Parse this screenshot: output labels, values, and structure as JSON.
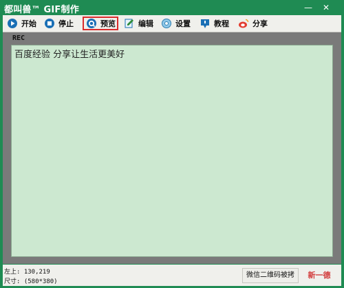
{
  "window": {
    "title": "都叫兽™ GIF制作",
    "minimize_icon": "minimize-icon",
    "close_icon": "close-icon"
  },
  "toolbar": {
    "items": [
      {
        "label": "开始",
        "icon": "play-icon"
      },
      {
        "label": "停止",
        "icon": "stop-icon"
      },
      {
        "label": "预览",
        "icon": "preview-icon"
      },
      {
        "label": "编辑",
        "icon": "edit-icon"
      },
      {
        "label": "设置",
        "icon": "gear-icon"
      },
      {
        "label": "教程",
        "icon": "tutorial-icon"
      },
      {
        "label": "分享",
        "icon": "weibo-icon"
      }
    ]
  },
  "recording": {
    "label": "REC",
    "text": "百度经验 分享让生活更美好"
  },
  "status": {
    "position": "左上: 130,219",
    "size": "尺寸: (580*380)",
    "qr_button": "微信二维码被拷",
    "brand": "新一德"
  },
  "colors": {
    "accent": "#1f8b53",
    "canvas": "#cce8d0",
    "highlight": "#d92b2b"
  }
}
